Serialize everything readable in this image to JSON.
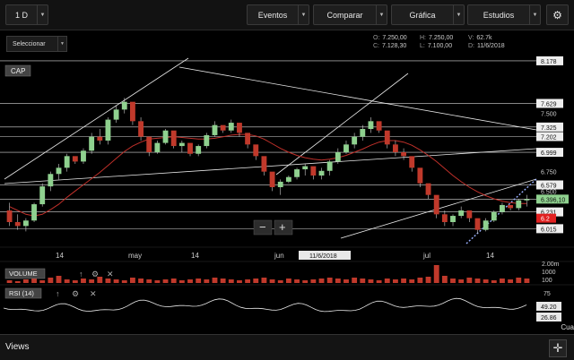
{
  "toolbar": {
    "period": "1 D",
    "events": "Eventos",
    "compare": "Comparar",
    "chart": "Gráfica",
    "studies": "Estudios"
  },
  "selector": {
    "label": "Seleccionar"
  },
  "ohlc": {
    "o_label": "O:",
    "o": "7.250,00",
    "c_label": "C:",
    "c": "7.128,30",
    "h_label": "H:",
    "h": "7.250,00",
    "l_label": "L:",
    "l": "7.100,00",
    "v_label": "V:",
    "v": "62.7k",
    "d_label": "D:",
    "d": "11/6/2018"
  },
  "panels": {
    "main": "CAP",
    "volume": "VOLUME",
    "rsi": "RSI (14)"
  },
  "price_axis": [
    "8.178",
    "7.629",
    "7.500",
    "7.325",
    "7.202",
    "6.999",
    "6.750",
    "6.579",
    "6.500",
    "6.396,10",
    "6.231",
    "6.015"
  ],
  "current_price": "6.396,10",
  "red_tag": "6.2",
  "x_labels": [
    "14",
    "may",
    "14",
    "jun",
    "jul",
    "14"
  ],
  "crosshair_date": "11/6/2018",
  "volume_axis": [
    "2.00m",
    "1000",
    "100"
  ],
  "rsi_axis": [
    "75",
    "49.20",
    "26.86"
  ],
  "rsi_value": "49.20",
  "rsi_value2": "26.86",
  "footer": {
    "views": "Views",
    "cua": "Cua"
  },
  "colors": {
    "up": "#8fd18f",
    "down": "#c0392b",
    "sma": "#c0302a",
    "bg": "#000000"
  },
  "chart_data": {
    "type": "candlestick",
    "ylim": [
      5800,
      8200
    ],
    "bars": [
      [
        6250,
        6350,
        6050,
        6100
      ],
      [
        6100,
        6200,
        6000,
        6050
      ],
      [
        6050,
        6150,
        5980,
        6120
      ],
      [
        6120,
        6350,
        6100,
        6330
      ],
      [
        6330,
        6600,
        6300,
        6560
      ],
      [
        6560,
        6750,
        6500,
        6720
      ],
      [
        6720,
        6850,
        6650,
        6800
      ],
      [
        6800,
        6980,
        6750,
        6950
      ],
      [
        6950,
        6900,
        6850,
        6880
      ],
      [
        6880,
        7050,
        6850,
        7020
      ],
      [
        7020,
        7250,
        6980,
        7200
      ],
      [
        7200,
        7300,
        7100,
        7150
      ],
      [
        7150,
        7450,
        7100,
        7420
      ],
      [
        7420,
        7600,
        7380,
        7550
      ],
      [
        7550,
        7700,
        7500,
        7650
      ],
      [
        7650,
        7550,
        7350,
        7400
      ],
      [
        7400,
        7450,
        7150,
        7200
      ],
      [
        7200,
        7050,
        6950,
        7000
      ],
      [
        7000,
        7150,
        6980,
        7120
      ],
      [
        7120,
        7300,
        7100,
        7280
      ],
      [
        7280,
        7250,
        7050,
        7080
      ],
      [
        7080,
        7150,
        7000,
        7120
      ],
      [
        7120,
        7050,
        6950,
        6980
      ],
      [
        6980,
        7100,
        6950,
        7080
      ],
      [
        7080,
        7250,
        7050,
        7220
      ],
      [
        7220,
        7400,
        7200,
        7350
      ],
      [
        7350,
        7300,
        7250,
        7280
      ],
      [
        7280,
        7420,
        7250,
        7380
      ],
      [
        7380,
        7350,
        7200,
        7250
      ],
      [
        7250,
        7200,
        7050,
        7100
      ],
      [
        7100,
        7000,
        6900,
        6950
      ],
      [
        6950,
        6800,
        6700,
        6750
      ],
      [
        6750,
        6600,
        6500,
        6550
      ],
      [
        6550,
        6650,
        6450,
        6620
      ],
      [
        6620,
        6700,
        6600,
        6680
      ],
      [
        6680,
        6800,
        6650,
        6780
      ],
      [
        6780,
        6850,
        6700,
        6820
      ],
      [
        6820,
        6750,
        6650,
        6700
      ],
      [
        6700,
        6800,
        6650,
        6760
      ],
      [
        6760,
        6900,
        6700,
        6880
      ],
      [
        6880,
        7050,
        6850,
        7000
      ],
      [
        7000,
        7150,
        6980,
        7100
      ],
      [
        7100,
        7250,
        7050,
        7200
      ],
      [
        7200,
        7350,
        7150,
        7300
      ],
      [
        7300,
        7450,
        7250,
        7400
      ],
      [
        7400,
        7350,
        7250,
        7280
      ],
      [
        7280,
        7200,
        7050,
        7100
      ],
      [
        7100,
        7150,
        6950,
        7000
      ],
      [
        7000,
        7050,
        6900,
        6950
      ],
      [
        6950,
        6850,
        6750,
        6800
      ],
      [
        6800,
        6700,
        6550,
        6600
      ],
      [
        6600,
        6550,
        6400,
        6450
      ],
      [
        6450,
        6300,
        6150,
        6200
      ],
      [
        6200,
        6250,
        6050,
        6100
      ],
      [
        6100,
        6200,
        6050,
        6180
      ],
      [
        6180,
        6300,
        6150,
        6250
      ],
      [
        6250,
        6200,
        6100,
        6150
      ],
      [
        6150,
        6050,
        5950,
        6000
      ],
      [
        6000,
        6150,
        5980,
        6120
      ],
      [
        6120,
        6250,
        6100,
        6230
      ],
      [
        6230,
        6350,
        6200,
        6320
      ],
      [
        6320,
        6300,
        6250,
        6280
      ],
      [
        6280,
        6400,
        6250,
        6380
      ],
      [
        6380,
        6450,
        6300,
        6396
      ]
    ],
    "sma": [
      6300,
      6250,
      6200,
      6180,
      6200,
      6260,
      6330,
      6420,
      6500,
      6580,
      6660,
      6740,
      6830,
      6920,
      7010,
      7080,
      7130,
      7170,
      7180,
      7190,
      7200,
      7190,
      7180,
      7170,
      7170,
      7180,
      7200,
      7220,
      7230,
      7230,
      7210,
      7170,
      7110,
      7050,
      7000,
      6960,
      6930,
      6910,
      6900,
      6910,
      6930,
      6960,
      7000,
      7040,
      7090,
      7130,
      7150,
      7150,
      7130,
      7090,
      7030,
      6960,
      6880,
      6790,
      6700,
      6620,
      6550,
      6490,
      6440,
      6400,
      6370,
      6350,
      6340,
      6340
    ]
  }
}
